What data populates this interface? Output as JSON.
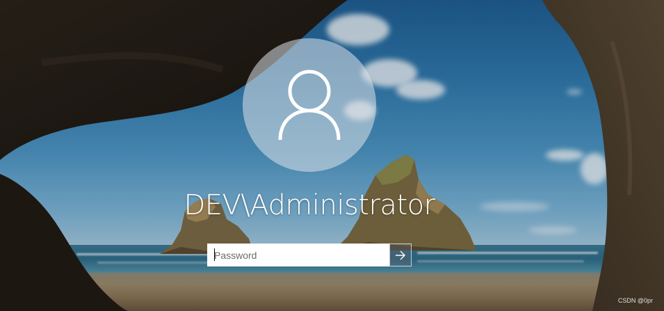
{
  "account": {
    "username": "DEV\\Administrator",
    "avatar_icon": "user-silhouette-icon"
  },
  "login": {
    "password_placeholder": "Password",
    "password_value": "",
    "submit_icon": "arrow-right-icon"
  },
  "watermark": "CSDN @0pr",
  "colors": {
    "text": "#ffffff",
    "avatar_bg": "rgba(220,226,232,0.55)",
    "input_bg": "#ffffff",
    "submit_bg": "rgba(90,100,110,0.45)"
  }
}
